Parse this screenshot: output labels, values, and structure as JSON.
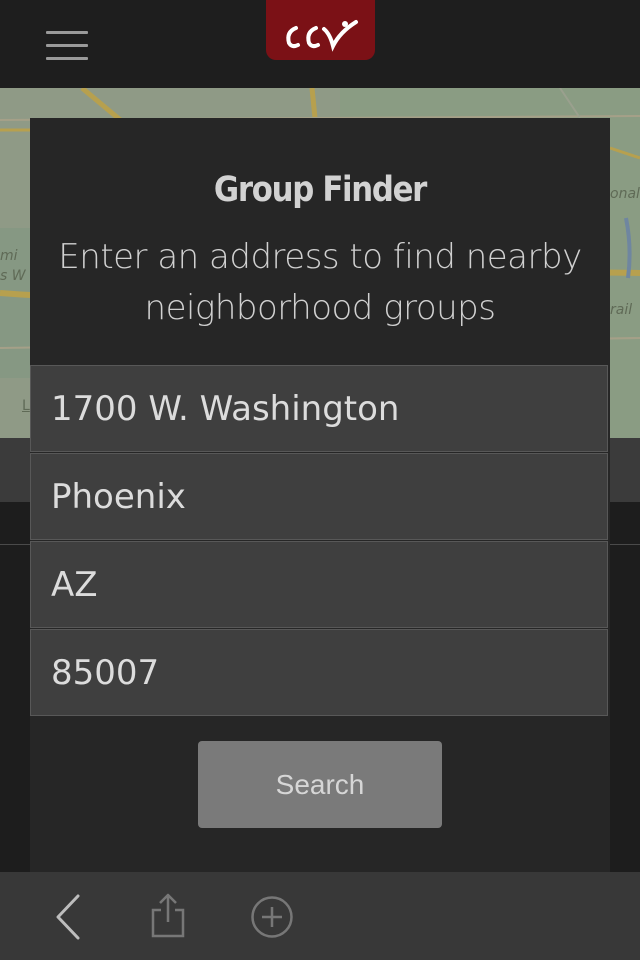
{
  "header": {
    "menu_icon": "hamburger-menu-icon",
    "logo_icon": "church-logo-icon",
    "logo_color": "#7b1116"
  },
  "map": {
    "labels": [
      "mi",
      "s W",
      "onal",
      "rail",
      "L"
    ]
  },
  "group_finder": {
    "title": "Group Finder",
    "subtitle": "Enter an address to find nearby neighborhood groups",
    "fields": {
      "street": "1700 W. Washington",
      "city": "Phoenix",
      "state": "AZ",
      "zip": "85007"
    },
    "search_label": "Search"
  },
  "toolbar": {
    "back_icon": "back-chevron-icon",
    "share_icon": "share-icon",
    "add_icon": "add-circle-icon"
  }
}
